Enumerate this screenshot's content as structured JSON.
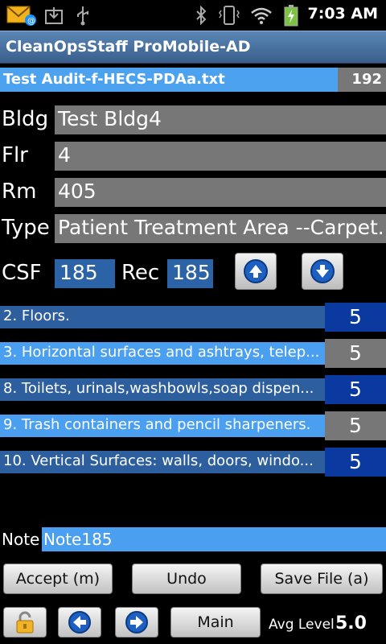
{
  "status_bar": {
    "time": "7:03 AM",
    "icons": [
      "email-notification-icon",
      "download-icon",
      "usb-icon",
      "bluetooth-icon",
      "vibrate-icon",
      "wifi-icon",
      "battery-charging-icon"
    ]
  },
  "app_title": "CleanOpsStaff ProMobile-AD",
  "file": {
    "name": "Test Audit-f-HECS-PDAa.txt",
    "count": "192"
  },
  "fields": {
    "bldg": {
      "label": "Bldg",
      "value": "Test Bldg4"
    },
    "flr": {
      "label": "Flr",
      "value": "4"
    },
    "rm": {
      "label": "Rm",
      "value": "405"
    },
    "type": {
      "label": "Type",
      "value": "Patient Treatment Area --Carpet..."
    }
  },
  "csf": {
    "label": "CSF",
    "value": "185",
    "rec_label": "Rec",
    "rec_value": "185"
  },
  "items": [
    {
      "text": "2. Floors.",
      "score": "5"
    },
    {
      "text": "3. Horizontal surfaces and ashtrays, telep...",
      "score": "5"
    },
    {
      "text": "8. Toilets, urinals,washbowls,soap dispen...",
      "score": "5"
    },
    {
      "text": "9. Trash containers and pencil sharpeners.",
      "score": "5"
    },
    {
      "text": "10. Vertical Surfaces: walls, doors, windo...",
      "score": "5"
    }
  ],
  "note": {
    "label": "Note",
    "value": "Note185"
  },
  "buttons": {
    "accept": "Accept (m)",
    "undo": "Undo",
    "save": "Save File (a)",
    "main": "Main"
  },
  "avg": {
    "label": "Avg Level",
    "value": "5.0"
  },
  "colors": {
    "accent_light": "#4a9ff0",
    "accent_dark": "#2d5f9e",
    "score_dark": "#0a3aa0",
    "field_gray": "#777777"
  }
}
